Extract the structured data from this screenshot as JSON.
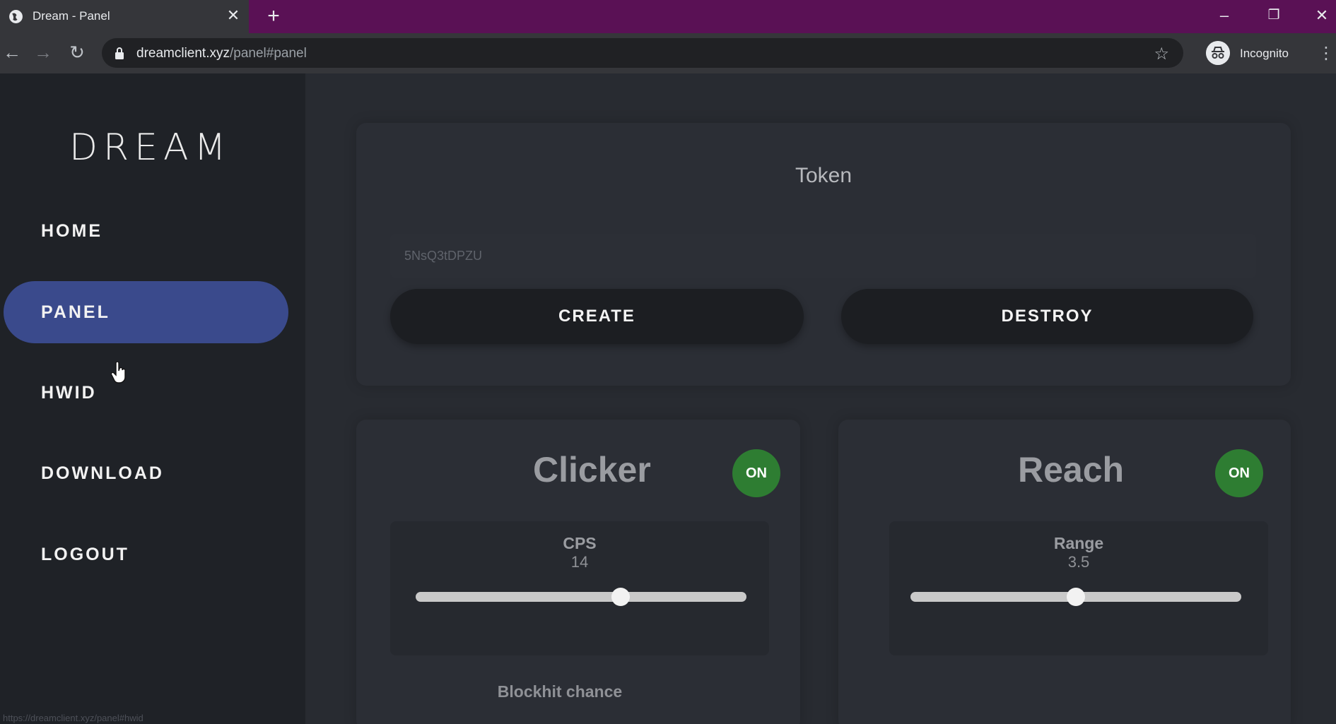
{
  "browser": {
    "tab_title": "Dream - Panel",
    "close_glyph": "✕",
    "new_tab_glyph": "+",
    "url_domain": "dreamclient.xyz",
    "url_path": "/panel#panel",
    "profile_label": "Incognito",
    "minimize_glyph": "–",
    "restore_glyph": "❐",
    "window_close_glyph": "✕",
    "back_glyph": "←",
    "forward_glyph": "→",
    "reload_glyph": "↻",
    "star_glyph": "☆",
    "menu_glyph": "⋮",
    "status_url": "https://dreamclient.xyz/panel#hwid",
    "frame_color": "#5a1155"
  },
  "sidebar": {
    "logo": "DREAM",
    "items": [
      {
        "label": "HOME",
        "active": false
      },
      {
        "label": "PANEL",
        "active": true
      },
      {
        "label": "HWID",
        "active": false
      },
      {
        "label": "DOWNLOAD",
        "active": false
      },
      {
        "label": "LOGOUT",
        "active": false
      }
    ],
    "active_color": "#3a4a8c"
  },
  "token": {
    "title": "Token",
    "value": "5NsQ3tDPZU",
    "create_label": "CREATE",
    "destroy_label": "DESTROY"
  },
  "modules": [
    {
      "title": "Clicker",
      "toggle_label": "ON",
      "slider_name": "CPS",
      "slider_value": "14",
      "slider_fraction": 0.62,
      "sub_label": "Blockhit chance"
    },
    {
      "title": "Reach",
      "toggle_label": "ON",
      "slider_name": "Range",
      "slider_value": "3.5",
      "slider_fraction": 0.5
    }
  ],
  "toggle_color": "#2e7d32"
}
